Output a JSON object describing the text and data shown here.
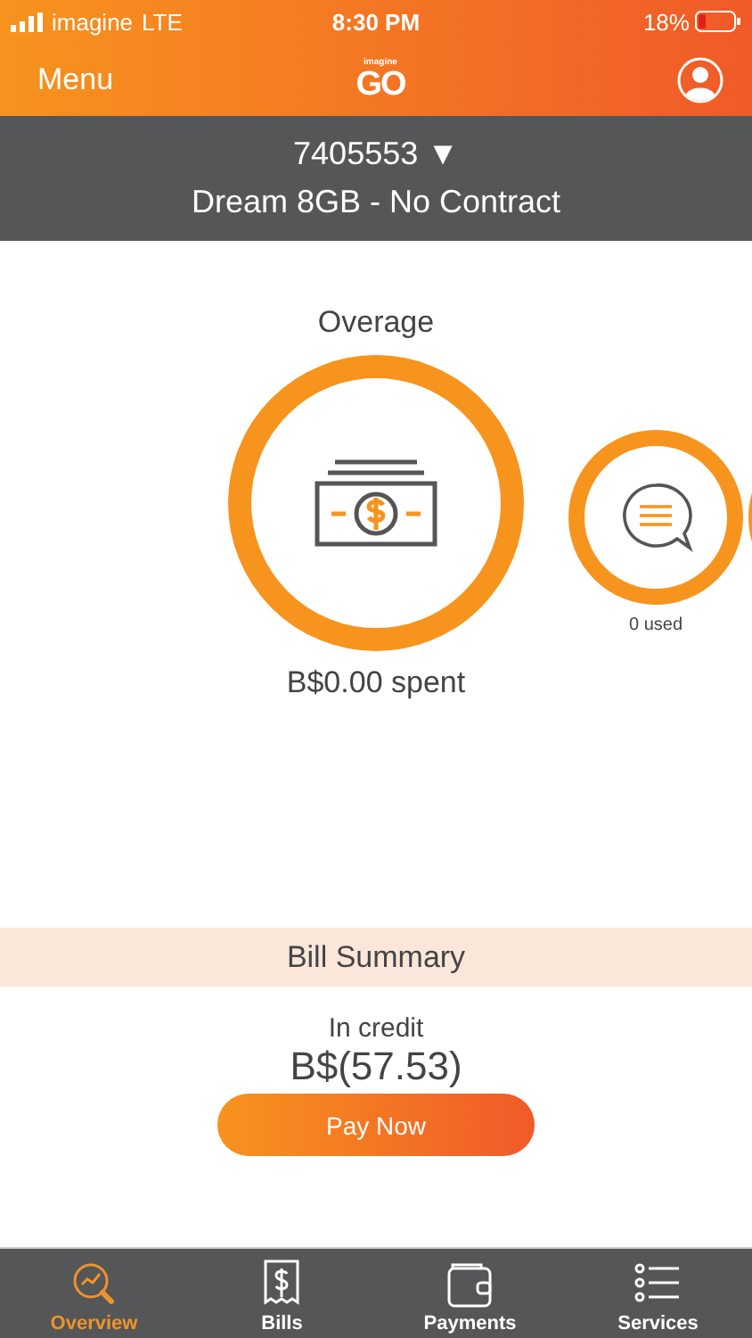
{
  "status_bar": {
    "carrier": "imagine",
    "network": "LTE",
    "time": "8:30 PM",
    "battery": "18%"
  },
  "header": {
    "menu": "Menu",
    "logo_small": "imagine",
    "logo_big": "GO"
  },
  "account": {
    "number": "7405553",
    "arrow": "▼",
    "plan": "Dream 8GB - No Contract"
  },
  "usage": [
    {
      "kind": "money",
      "title": "Overage",
      "caption": "B$0.00 spent"
    },
    {
      "kind": "message",
      "caption": "0 used"
    },
    {
      "kind": "partial"
    }
  ],
  "bill_summary": {
    "title": "Bill Summary",
    "status": "In credit",
    "amount": "B$(57.53)",
    "button": "Pay Now"
  },
  "tabs": [
    {
      "label": "Overview",
      "kind": "overview",
      "selected": true
    },
    {
      "label": "Bills",
      "kind": "bills",
      "selected": false
    },
    {
      "label": "Payments",
      "kind": "payments",
      "selected": false
    },
    {
      "label": "Services",
      "kind": "services",
      "selected": false
    }
  ]
}
